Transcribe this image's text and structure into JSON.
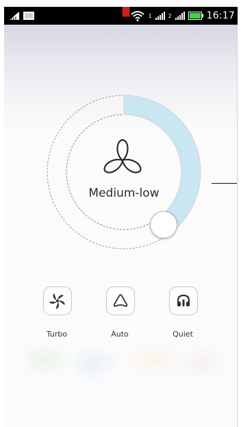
{
  "status_bar": {
    "time": "16:17",
    "network_1": "1",
    "network_2": "2"
  },
  "fan": {
    "mode_title": "Medium-low",
    "level_fraction": 0.37
  },
  "modes": [
    {
      "label": "Turbo",
      "icon": "turbo-fan-icon"
    },
    {
      "label": "Auto",
      "icon": "auto-triangle-icon"
    },
    {
      "label": "Quiet",
      "icon": "headphones-icon"
    }
  ],
  "colors": {
    "arc_fill": "#c9e6f3",
    "status_bar": "#000000",
    "battery": "#3bd63b"
  }
}
